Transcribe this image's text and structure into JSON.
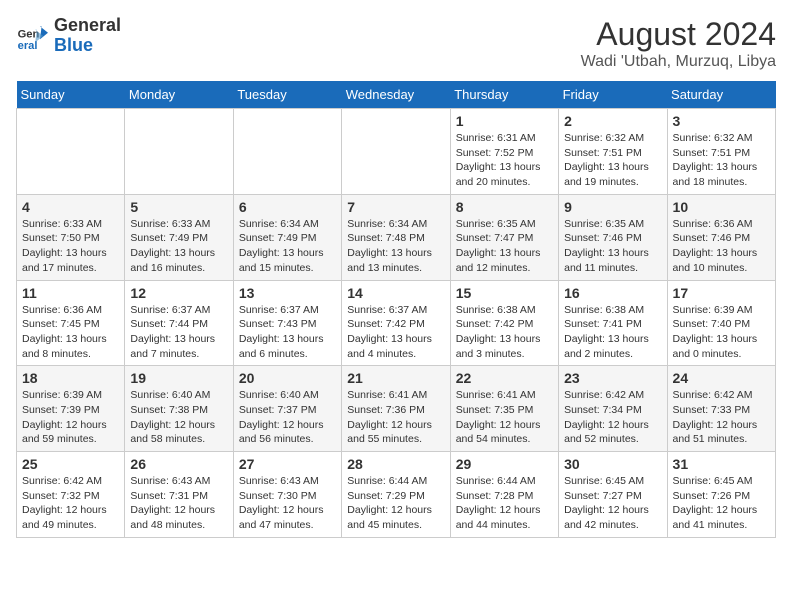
{
  "logo": {
    "line1": "General",
    "line2": "Blue"
  },
  "title": "August 2024",
  "subtitle": "Wadi 'Utbah, Murzuq, Libya",
  "days_of_week": [
    "Sunday",
    "Monday",
    "Tuesday",
    "Wednesday",
    "Thursday",
    "Friday",
    "Saturday"
  ],
  "weeks": [
    [
      {
        "day": "",
        "text": ""
      },
      {
        "day": "",
        "text": ""
      },
      {
        "day": "",
        "text": ""
      },
      {
        "day": "",
        "text": ""
      },
      {
        "day": "1",
        "text": "Sunrise: 6:31 AM\nSunset: 7:52 PM\nDaylight: 13 hours\nand 20 minutes."
      },
      {
        "day": "2",
        "text": "Sunrise: 6:32 AM\nSunset: 7:51 PM\nDaylight: 13 hours\nand 19 minutes."
      },
      {
        "day": "3",
        "text": "Sunrise: 6:32 AM\nSunset: 7:51 PM\nDaylight: 13 hours\nand 18 minutes."
      }
    ],
    [
      {
        "day": "4",
        "text": "Sunrise: 6:33 AM\nSunset: 7:50 PM\nDaylight: 13 hours\nand 17 minutes."
      },
      {
        "day": "5",
        "text": "Sunrise: 6:33 AM\nSunset: 7:49 PM\nDaylight: 13 hours\nand 16 minutes."
      },
      {
        "day": "6",
        "text": "Sunrise: 6:34 AM\nSunset: 7:49 PM\nDaylight: 13 hours\nand 15 minutes."
      },
      {
        "day": "7",
        "text": "Sunrise: 6:34 AM\nSunset: 7:48 PM\nDaylight: 13 hours\nand 13 minutes."
      },
      {
        "day": "8",
        "text": "Sunrise: 6:35 AM\nSunset: 7:47 PM\nDaylight: 13 hours\nand 12 minutes."
      },
      {
        "day": "9",
        "text": "Sunrise: 6:35 AM\nSunset: 7:46 PM\nDaylight: 13 hours\nand 11 minutes."
      },
      {
        "day": "10",
        "text": "Sunrise: 6:36 AM\nSunset: 7:46 PM\nDaylight: 13 hours\nand 10 minutes."
      }
    ],
    [
      {
        "day": "11",
        "text": "Sunrise: 6:36 AM\nSunset: 7:45 PM\nDaylight: 13 hours\nand 8 minutes."
      },
      {
        "day": "12",
        "text": "Sunrise: 6:37 AM\nSunset: 7:44 PM\nDaylight: 13 hours\nand 7 minutes."
      },
      {
        "day": "13",
        "text": "Sunrise: 6:37 AM\nSunset: 7:43 PM\nDaylight: 13 hours\nand 6 minutes."
      },
      {
        "day": "14",
        "text": "Sunrise: 6:37 AM\nSunset: 7:42 PM\nDaylight: 13 hours\nand 4 minutes."
      },
      {
        "day": "15",
        "text": "Sunrise: 6:38 AM\nSunset: 7:42 PM\nDaylight: 13 hours\nand 3 minutes."
      },
      {
        "day": "16",
        "text": "Sunrise: 6:38 AM\nSunset: 7:41 PM\nDaylight: 13 hours\nand 2 minutes."
      },
      {
        "day": "17",
        "text": "Sunrise: 6:39 AM\nSunset: 7:40 PM\nDaylight: 13 hours\nand 0 minutes."
      }
    ],
    [
      {
        "day": "18",
        "text": "Sunrise: 6:39 AM\nSunset: 7:39 PM\nDaylight: 12 hours\nand 59 minutes."
      },
      {
        "day": "19",
        "text": "Sunrise: 6:40 AM\nSunset: 7:38 PM\nDaylight: 12 hours\nand 58 minutes."
      },
      {
        "day": "20",
        "text": "Sunrise: 6:40 AM\nSunset: 7:37 PM\nDaylight: 12 hours\nand 56 minutes."
      },
      {
        "day": "21",
        "text": "Sunrise: 6:41 AM\nSunset: 7:36 PM\nDaylight: 12 hours\nand 55 minutes."
      },
      {
        "day": "22",
        "text": "Sunrise: 6:41 AM\nSunset: 7:35 PM\nDaylight: 12 hours\nand 54 minutes."
      },
      {
        "day": "23",
        "text": "Sunrise: 6:42 AM\nSunset: 7:34 PM\nDaylight: 12 hours\nand 52 minutes."
      },
      {
        "day": "24",
        "text": "Sunrise: 6:42 AM\nSunset: 7:33 PM\nDaylight: 12 hours\nand 51 minutes."
      }
    ],
    [
      {
        "day": "25",
        "text": "Sunrise: 6:42 AM\nSunset: 7:32 PM\nDaylight: 12 hours\nand 49 minutes."
      },
      {
        "day": "26",
        "text": "Sunrise: 6:43 AM\nSunset: 7:31 PM\nDaylight: 12 hours\nand 48 minutes."
      },
      {
        "day": "27",
        "text": "Sunrise: 6:43 AM\nSunset: 7:30 PM\nDaylight: 12 hours\nand 47 minutes."
      },
      {
        "day": "28",
        "text": "Sunrise: 6:44 AM\nSunset: 7:29 PM\nDaylight: 12 hours\nand 45 minutes."
      },
      {
        "day": "29",
        "text": "Sunrise: 6:44 AM\nSunset: 7:28 PM\nDaylight: 12 hours\nand 44 minutes."
      },
      {
        "day": "30",
        "text": "Sunrise: 6:45 AM\nSunset: 7:27 PM\nDaylight: 12 hours\nand 42 minutes."
      },
      {
        "day": "31",
        "text": "Sunrise: 6:45 AM\nSunset: 7:26 PM\nDaylight: 12 hours\nand 41 minutes."
      }
    ]
  ]
}
